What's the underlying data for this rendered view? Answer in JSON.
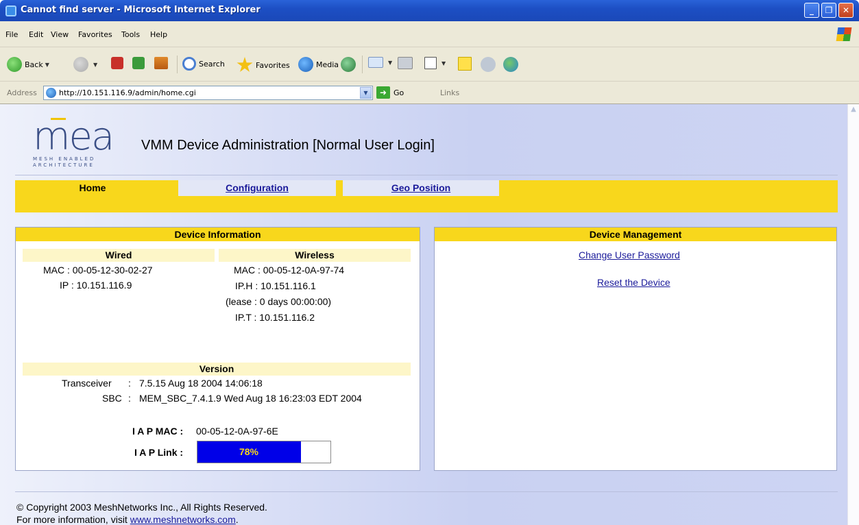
{
  "window": {
    "title": "Cannot find server - Microsoft Internet Explorer",
    "buttons": {
      "minimize": "_",
      "maximize": "❐",
      "close": "✕"
    }
  },
  "menubar": [
    "File",
    "Edit",
    "View",
    "Favorites",
    "Tools",
    "Help"
  ],
  "toolbar": {
    "back": "Back",
    "search": "Search",
    "favorites": "Favorites",
    "media": "Media"
  },
  "addressbar": {
    "label": "Address",
    "url": "http://10.151.116.9/admin/home.cgi",
    "go": "Go",
    "links": "Links"
  },
  "header": {
    "logo_text": "mea",
    "logo_sub1": "MESH ENABLED",
    "logo_sub2": "ARCHITECTURE",
    "title": "VMM Device Administration [Normal User Login]"
  },
  "nav": {
    "tabs": [
      {
        "label": "Home",
        "active": true
      },
      {
        "label": "Configuration",
        "active": false
      },
      {
        "label": "Geo Position",
        "active": false
      }
    ]
  },
  "device_info": {
    "title": "Device Information",
    "wired": {
      "heading": "Wired",
      "mac": "MAC : 00-05-12-30-02-27",
      "ip": "IP : 10.151.116.9"
    },
    "wireless": {
      "heading": "Wireless",
      "mac": "MAC : 00-05-12-0A-97-74",
      "iph": "IP.H : 10.151.116.1",
      "lease": "(lease : 0 days 00:00:00)",
      "ipt": "IP.T : 10.151.116.2"
    },
    "version": {
      "heading": "Version",
      "transceiver_label": "Transceiver",
      "transceiver_value": "7.5.15 Aug 18 2004 14:06:18",
      "sbc_label": "SBC",
      "sbc_value": "MEM_SBC_7.4.1.9 Wed Aug 18 16:23:03 EDT 2004",
      "colon": ":"
    },
    "iap_mac_label": "I A P MAC :",
    "iap_mac_value": "00-05-12-0A-97-6E",
    "iap_link_label": "I A P Link :",
    "iap_link_text": "78%",
    "iap_link_value": 0.78
  },
  "device_mgmt": {
    "title": "Device Management",
    "links": [
      "Change User Password",
      "Reset the Device"
    ]
  },
  "footer": {
    "copyright": "© Copyright 2003 MeshNetworks Inc., All Rights Reserved.",
    "more_info_prefix": "For more information, visit ",
    "more_info_link": "www.meshnetworks.com",
    "more_info_suffix": "."
  }
}
